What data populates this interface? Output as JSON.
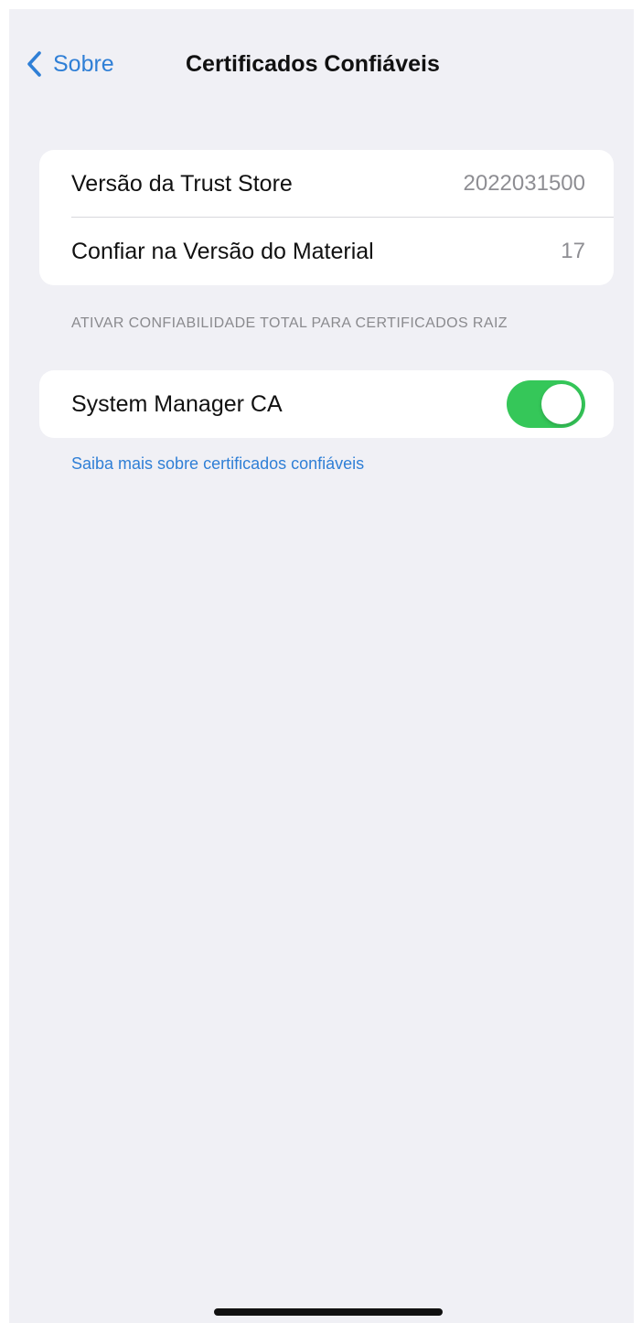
{
  "nav": {
    "back_label": "Sobre",
    "back_icon": "chevron-left-icon",
    "title": "Certificados Confiáveis"
  },
  "info": {
    "rows": [
      {
        "label": "Versão da Trust Store",
        "value": "2022031500"
      },
      {
        "label": "Confiar na Versão do Material",
        "value": "17"
      }
    ]
  },
  "trust_section": {
    "header": "ATIVAR CONFIABILIDADE TOTAL PARA CERTIFICADOS RAIZ",
    "certificates": [
      {
        "label": "System Manager CA",
        "enabled": true
      }
    ]
  },
  "footer_link": "Saiba mais sobre certificados confiáveis",
  "colors": {
    "accent": "#2f7fd6",
    "toggle_on": "#35c759",
    "background": "#f0f0f5"
  }
}
